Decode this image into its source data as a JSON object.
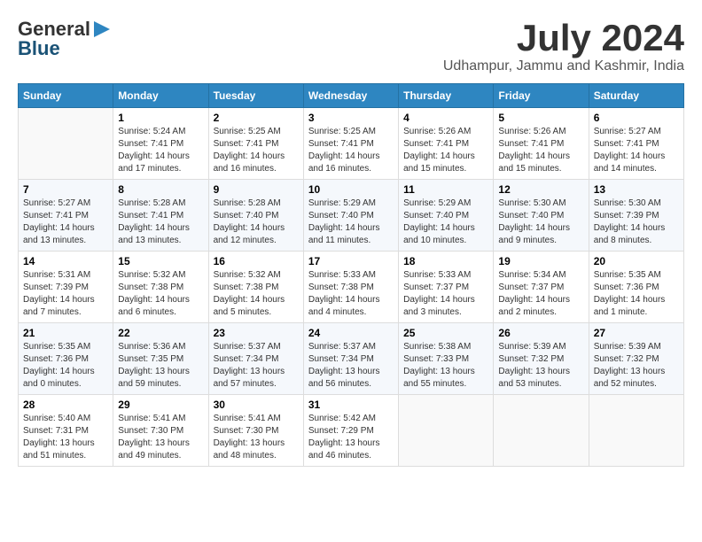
{
  "header": {
    "logo_general": "General",
    "logo_blue": "Blue",
    "month_title": "July 2024",
    "location": "Udhampur, Jammu and Kashmir, India"
  },
  "days_of_week": [
    "Sunday",
    "Monday",
    "Tuesday",
    "Wednesday",
    "Thursday",
    "Friday",
    "Saturday"
  ],
  "weeks": [
    [
      {
        "day": "",
        "sunrise": "",
        "sunset": "",
        "daylight": ""
      },
      {
        "day": "1",
        "sunrise": "Sunrise: 5:24 AM",
        "sunset": "Sunset: 7:41 PM",
        "daylight": "Daylight: 14 hours and 17 minutes."
      },
      {
        "day": "2",
        "sunrise": "Sunrise: 5:25 AM",
        "sunset": "Sunset: 7:41 PM",
        "daylight": "Daylight: 14 hours and 16 minutes."
      },
      {
        "day": "3",
        "sunrise": "Sunrise: 5:25 AM",
        "sunset": "Sunset: 7:41 PM",
        "daylight": "Daylight: 14 hours and 16 minutes."
      },
      {
        "day": "4",
        "sunrise": "Sunrise: 5:26 AM",
        "sunset": "Sunset: 7:41 PM",
        "daylight": "Daylight: 14 hours and 15 minutes."
      },
      {
        "day": "5",
        "sunrise": "Sunrise: 5:26 AM",
        "sunset": "Sunset: 7:41 PM",
        "daylight": "Daylight: 14 hours and 15 minutes."
      },
      {
        "day": "6",
        "sunrise": "Sunrise: 5:27 AM",
        "sunset": "Sunset: 7:41 PM",
        "daylight": "Daylight: 14 hours and 14 minutes."
      }
    ],
    [
      {
        "day": "7",
        "sunrise": "Sunrise: 5:27 AM",
        "sunset": "Sunset: 7:41 PM",
        "daylight": "Daylight: 14 hours and 13 minutes."
      },
      {
        "day": "8",
        "sunrise": "Sunrise: 5:28 AM",
        "sunset": "Sunset: 7:41 PM",
        "daylight": "Daylight: 14 hours and 13 minutes."
      },
      {
        "day": "9",
        "sunrise": "Sunrise: 5:28 AM",
        "sunset": "Sunset: 7:40 PM",
        "daylight": "Daylight: 14 hours and 12 minutes."
      },
      {
        "day": "10",
        "sunrise": "Sunrise: 5:29 AM",
        "sunset": "Sunset: 7:40 PM",
        "daylight": "Daylight: 14 hours and 11 minutes."
      },
      {
        "day": "11",
        "sunrise": "Sunrise: 5:29 AM",
        "sunset": "Sunset: 7:40 PM",
        "daylight": "Daylight: 14 hours and 10 minutes."
      },
      {
        "day": "12",
        "sunrise": "Sunrise: 5:30 AM",
        "sunset": "Sunset: 7:40 PM",
        "daylight": "Daylight: 14 hours and 9 minutes."
      },
      {
        "day": "13",
        "sunrise": "Sunrise: 5:30 AM",
        "sunset": "Sunset: 7:39 PM",
        "daylight": "Daylight: 14 hours and 8 minutes."
      }
    ],
    [
      {
        "day": "14",
        "sunrise": "Sunrise: 5:31 AM",
        "sunset": "Sunset: 7:39 PM",
        "daylight": "Daylight: 14 hours and 7 minutes."
      },
      {
        "day": "15",
        "sunrise": "Sunrise: 5:32 AM",
        "sunset": "Sunset: 7:38 PM",
        "daylight": "Daylight: 14 hours and 6 minutes."
      },
      {
        "day": "16",
        "sunrise": "Sunrise: 5:32 AM",
        "sunset": "Sunset: 7:38 PM",
        "daylight": "Daylight: 14 hours and 5 minutes."
      },
      {
        "day": "17",
        "sunrise": "Sunrise: 5:33 AM",
        "sunset": "Sunset: 7:38 PM",
        "daylight": "Daylight: 14 hours and 4 minutes."
      },
      {
        "day": "18",
        "sunrise": "Sunrise: 5:33 AM",
        "sunset": "Sunset: 7:37 PM",
        "daylight": "Daylight: 14 hours and 3 minutes."
      },
      {
        "day": "19",
        "sunrise": "Sunrise: 5:34 AM",
        "sunset": "Sunset: 7:37 PM",
        "daylight": "Daylight: 14 hours and 2 minutes."
      },
      {
        "day": "20",
        "sunrise": "Sunrise: 5:35 AM",
        "sunset": "Sunset: 7:36 PM",
        "daylight": "Daylight: 14 hours and 1 minute."
      }
    ],
    [
      {
        "day": "21",
        "sunrise": "Sunrise: 5:35 AM",
        "sunset": "Sunset: 7:36 PM",
        "daylight": "Daylight: 14 hours and 0 minutes."
      },
      {
        "day": "22",
        "sunrise": "Sunrise: 5:36 AM",
        "sunset": "Sunset: 7:35 PM",
        "daylight": "Daylight: 13 hours and 59 minutes."
      },
      {
        "day": "23",
        "sunrise": "Sunrise: 5:37 AM",
        "sunset": "Sunset: 7:34 PM",
        "daylight": "Daylight: 13 hours and 57 minutes."
      },
      {
        "day": "24",
        "sunrise": "Sunrise: 5:37 AM",
        "sunset": "Sunset: 7:34 PM",
        "daylight": "Daylight: 13 hours and 56 minutes."
      },
      {
        "day": "25",
        "sunrise": "Sunrise: 5:38 AM",
        "sunset": "Sunset: 7:33 PM",
        "daylight": "Daylight: 13 hours and 55 minutes."
      },
      {
        "day": "26",
        "sunrise": "Sunrise: 5:39 AM",
        "sunset": "Sunset: 7:32 PM",
        "daylight": "Daylight: 13 hours and 53 minutes."
      },
      {
        "day": "27",
        "sunrise": "Sunrise: 5:39 AM",
        "sunset": "Sunset: 7:32 PM",
        "daylight": "Daylight: 13 hours and 52 minutes."
      }
    ],
    [
      {
        "day": "28",
        "sunrise": "Sunrise: 5:40 AM",
        "sunset": "Sunset: 7:31 PM",
        "daylight": "Daylight: 13 hours and 51 minutes."
      },
      {
        "day": "29",
        "sunrise": "Sunrise: 5:41 AM",
        "sunset": "Sunset: 7:30 PM",
        "daylight": "Daylight: 13 hours and 49 minutes."
      },
      {
        "day": "30",
        "sunrise": "Sunrise: 5:41 AM",
        "sunset": "Sunset: 7:30 PM",
        "daylight": "Daylight: 13 hours and 48 minutes."
      },
      {
        "day": "31",
        "sunrise": "Sunrise: 5:42 AM",
        "sunset": "Sunset: 7:29 PM",
        "daylight": "Daylight: 13 hours and 46 minutes."
      },
      {
        "day": "",
        "sunrise": "",
        "sunset": "",
        "daylight": ""
      },
      {
        "day": "",
        "sunrise": "",
        "sunset": "",
        "daylight": ""
      },
      {
        "day": "",
        "sunrise": "",
        "sunset": "",
        "daylight": ""
      }
    ]
  ]
}
